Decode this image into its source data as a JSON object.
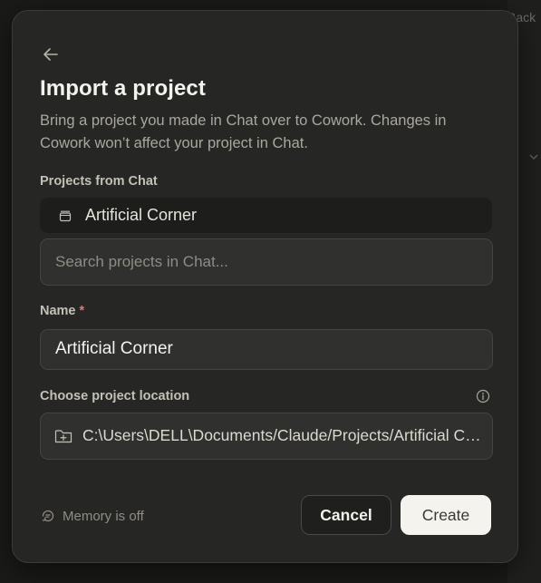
{
  "background": {
    "back_label": "Back"
  },
  "dialog": {
    "title": "Import a project",
    "subtitle": "Bring a project you made in Chat over to Cowork. Changes in Cowork won’t affect your project in Chat.",
    "projects_from_chat": {
      "label": "Projects from Chat",
      "selected_project": "Artificial Corner",
      "search_placeholder": "Search projects in Chat..."
    },
    "name": {
      "label": "Name",
      "required_marker": "*",
      "value": "Artificial Corner"
    },
    "location": {
      "label": "Choose project location",
      "path": "C:\\Users\\DELL\\Documents/Claude/Projects/Artificial Corner"
    },
    "memory_status": "Memory is off",
    "buttons": {
      "cancel": "Cancel",
      "create": "Create"
    }
  },
  "colors": {
    "dialog_bg": "#262624",
    "primary_button_bg": "#f5f3ee",
    "required_accent": "#e07a6f"
  }
}
